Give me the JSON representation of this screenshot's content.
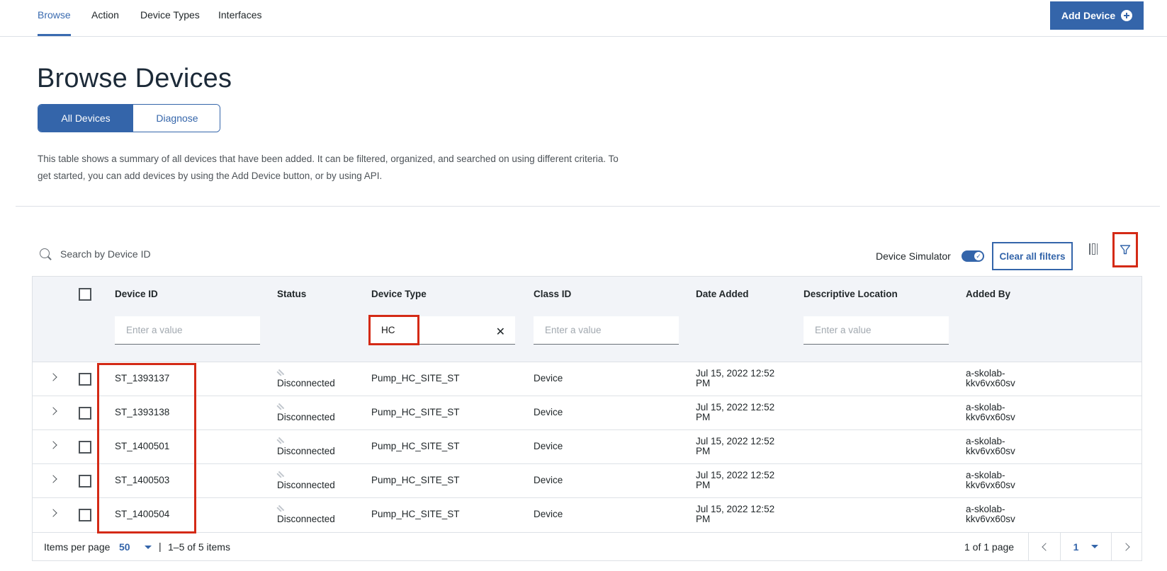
{
  "nav": {
    "tabs": [
      {
        "label": "Browse",
        "active": true
      },
      {
        "label": "Action",
        "active": false
      },
      {
        "label": "Device Types",
        "active": false
      },
      {
        "label": "Interfaces",
        "active": false
      }
    ],
    "add_device_label": "Add Device",
    "add_device_icon": "plus-circle-icon"
  },
  "page": {
    "title": "Browse Devices",
    "segments": [
      {
        "label": "All Devices",
        "selected": true
      },
      {
        "label": "Diagnose",
        "selected": false
      }
    ],
    "description": "This table shows a summary of all devices that have been added. It can be filtered, organized, and searched on using different criteria. To get started, you can add devices by using the Add Device button, or by using API."
  },
  "toolbar": {
    "search_placeholder": "Search by Device ID",
    "search_icon": "search-icon",
    "simulator_label": "Device Simulator",
    "simulator_on": true,
    "clear_filters_label": "Clear all filters",
    "columns_icon": "column-settings-icon",
    "filter_icon": "filter-icon"
  },
  "table": {
    "columns": [
      "Device ID",
      "Status",
      "Device Type",
      "Class ID",
      "Date Added",
      "Descriptive Location",
      "Added By"
    ],
    "filters": {
      "device_id": {
        "value": "",
        "placeholder": "Enter a value"
      },
      "device_type": {
        "value": "HC",
        "placeholder": "Enter a value"
      },
      "class_id": {
        "value": "",
        "placeholder": "Enter a value"
      },
      "location": {
        "value": "",
        "placeholder": "Enter a value"
      }
    },
    "rows": [
      {
        "device_id": "ST_1393137",
        "status": "Disconnected",
        "device_type": "Pump_HC_SITE_ST",
        "class_id": "Device",
        "date_line1": "Jul 15, 2022 12:52",
        "date_line2": "PM",
        "location": "",
        "added_by_line1": "a-skolab-",
        "added_by_line2": "kkv6vx60sv"
      },
      {
        "device_id": "ST_1393138",
        "status": "Disconnected",
        "device_type": "Pump_HC_SITE_ST",
        "class_id": "Device",
        "date_line1": "Jul 15, 2022 12:52",
        "date_line2": "PM",
        "location": "",
        "added_by_line1": "a-skolab-",
        "added_by_line2": "kkv6vx60sv"
      },
      {
        "device_id": "ST_1400501",
        "status": "Disconnected",
        "device_type": "Pump_HC_SITE_ST",
        "class_id": "Device",
        "date_line1": "Jul 15, 2022 12:52",
        "date_line2": "PM",
        "location": "",
        "added_by_line1": "a-skolab-",
        "added_by_line2": "kkv6vx60sv"
      },
      {
        "device_id": "ST_1400503",
        "status": "Disconnected",
        "device_type": "Pump_HC_SITE_ST",
        "class_id": "Device",
        "date_line1": "Jul 15, 2022 12:52",
        "date_line2": "PM",
        "location": "",
        "added_by_line1": "a-skolab-",
        "added_by_line2": "kkv6vx60sv"
      },
      {
        "device_id": "ST_1400504",
        "status": "Disconnected",
        "device_type": "Pump_HC_SITE_ST",
        "class_id": "Device",
        "date_line1": "Jul 15, 2022 12:52",
        "date_line2": "PM",
        "location": "",
        "added_by_line1": "a-skolab-",
        "added_by_line2": "kkv6vx60sv"
      }
    ]
  },
  "pagination": {
    "items_per_page_label": "Items per page",
    "items_per_page_value": "50",
    "separator": "|",
    "range_text": "1–5 of 5 items",
    "page_of_text": "1 of 1 page",
    "current_page": "1"
  },
  "colors": {
    "accent": "#3465aa",
    "highlight": "#d42a16",
    "header_bg": "#f2f4f8"
  }
}
